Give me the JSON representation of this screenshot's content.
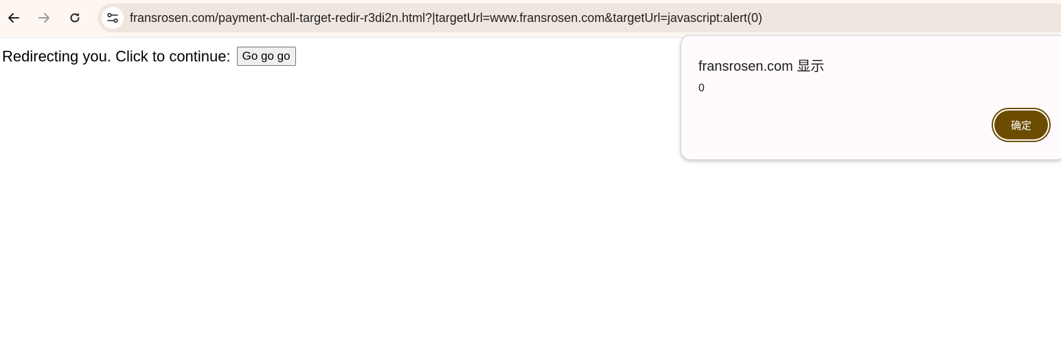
{
  "browser": {
    "url": "fransrosen.com/payment-chall-target-redir-r3di2n.html?|targetUrl=www.fransrosen.com&targetUrl=javascript:alert(0)",
    "back_icon": "arrow-left-icon",
    "forward_icon": "arrow-right-icon",
    "reload_icon": "reload-icon",
    "site_info_icon": "tune-icon"
  },
  "page": {
    "message": "Redirecting you. Click to continue:",
    "button_label": "Go go go"
  },
  "dialog": {
    "title": "fransrosen.com 显示",
    "message": "0",
    "ok_label": "确定",
    "accent_color": "#6b4c00"
  }
}
